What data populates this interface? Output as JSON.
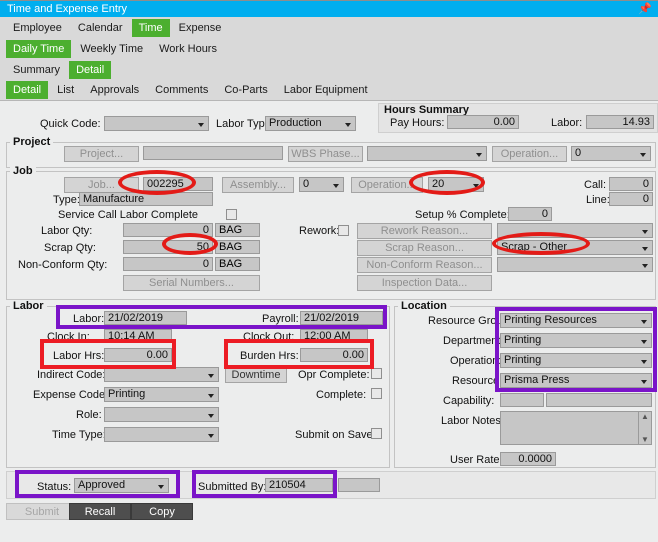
{
  "window": {
    "title": "Time and Expense Entry",
    "pin_icon": "pin-icon"
  },
  "tabs_level1": [
    {
      "label": "Employee",
      "active": false
    },
    {
      "label": "Calendar",
      "active": false
    },
    {
      "label": "Time",
      "active": true
    },
    {
      "label": "Expense",
      "active": false
    }
  ],
  "tabs_level2": [
    {
      "label": "Daily Time",
      "active": true
    },
    {
      "label": "Weekly Time",
      "active": false
    },
    {
      "label": "Work Hours",
      "active": false
    }
  ],
  "tabs_level3": [
    {
      "label": "Summary",
      "active": false
    },
    {
      "label": "Detail",
      "active": true
    }
  ],
  "tabs_level4": [
    {
      "label": "Detail",
      "active": true
    },
    {
      "label": "List",
      "active": false
    },
    {
      "label": "Approvals",
      "active": false
    },
    {
      "label": "Comments",
      "active": false
    },
    {
      "label": "Co-Parts",
      "active": false
    },
    {
      "label": "Labor Equipment",
      "active": false
    }
  ],
  "top": {
    "quick_code_label": "Quick Code:",
    "quick_code_value": "",
    "labor_type_label": "Labor Type:",
    "labor_type_value": "Production"
  },
  "hours_summary": {
    "group_label": "Hours Summary",
    "pay_hours_label": "Pay Hours:",
    "pay_hours_value": "0.00",
    "labor_label": "Labor:",
    "labor_value": "14.93"
  },
  "project": {
    "group_label": "Project",
    "project_button": "Project...",
    "project_value": "",
    "wbs_phase_button": "WBS Phase...",
    "wbs_phase_value": "",
    "operation_button": "Operation...",
    "operation_value": "0"
  },
  "job": {
    "group_label": "Job",
    "job_button": "Job...",
    "job_value": "002295",
    "assembly_button": "Assembly...",
    "assembly_value": "0",
    "operation_button": "Operation...",
    "operation_value": "20",
    "call_label": "Call:",
    "call_value": "0",
    "line_label": "Line:",
    "line_value": "0",
    "type_label": "Type:",
    "type_value": "Manufacture",
    "service_call_label": "Service Call Labor Complete",
    "setup_pct_label": "Setup % Complete:",
    "setup_pct_value": "0",
    "labor_qty_label": "Labor Qty:",
    "labor_qty_value": "0",
    "labor_qty_uom": "BAG",
    "scrap_qty_label": "Scrap Qty:",
    "scrap_qty_value": "50",
    "scrap_qty_uom": "BAG",
    "nonconform_qty_label": "Non-Conform Qty:",
    "nonconform_qty_value": "0",
    "nonconform_qty_uom": "BAG",
    "serial_numbers_button": "Serial Numbers...",
    "rework_label": "Rework:",
    "rework_reason_button": "Rework Reason...",
    "rework_reason_value": "",
    "scrap_reason_button": "Scrap Reason...",
    "scrap_reason_value": "Scrap - Other",
    "nonconform_reason_button": "Non-Conform Reason...",
    "nonconform_reason_value": "",
    "inspection_data_button": "Inspection Data..."
  },
  "labor": {
    "group_label": "Labor",
    "labor_date_label": "Labor:",
    "labor_date_value": "21/02/2019",
    "payroll_date_label": "Payroll:",
    "payroll_date_value": "21/02/2019",
    "clock_in_label": "Clock In:",
    "clock_in_value": "10:14 AM",
    "clock_out_label": "Clock Out:",
    "clock_out_value": "12:00 AM",
    "labor_hrs_label": "Labor Hrs:",
    "labor_hrs_value": "0.00",
    "burden_hrs_label": "Burden Hrs:",
    "burden_hrs_value": "0.00",
    "indirect_code_label": "Indirect Code:",
    "indirect_code_value": "",
    "downtime_button": "Downtime",
    "opr_complete_label": "Opr Complete:",
    "expense_code_label": "Expense Code:",
    "expense_code_value": "Printing",
    "complete_label": "Complete:",
    "role_label": "Role:",
    "role_value": "",
    "time_type_label": "Time Type:",
    "time_type_value": "",
    "submit_on_save_label": "Submit on Save:"
  },
  "location": {
    "group_label": "Location",
    "resource_group_label": "Resource Group:",
    "resource_group_value": "Printing Resources",
    "department_label": "Department:",
    "department_value": "Printing",
    "operation_label": "Operation:",
    "operation_value": "Printing",
    "resource_label": "Resource:",
    "resource_value": "Prisma Press",
    "capability_label": "Capability:",
    "capability_value": "",
    "labor_notes_label": "Labor Notes:",
    "labor_notes_value": "",
    "user_rate_label": "User Rate:",
    "user_rate_value": "0.0000"
  },
  "status_bar": {
    "status_label": "Status:",
    "status_value": "Approved",
    "submitted_by_label": "Submitted By:",
    "submitted_by_value": "210504",
    "extra_value": ""
  },
  "actions": {
    "submit_label": "Submit",
    "recall_label": "Recall",
    "copy_label": "Copy"
  },
  "colors": {
    "titlebar": "#00aeef",
    "tab_active": "#4caf2f",
    "annotation_red": "#ec1c24",
    "annotation_purple": "#7a14c8",
    "window_bg": "#eceded"
  }
}
